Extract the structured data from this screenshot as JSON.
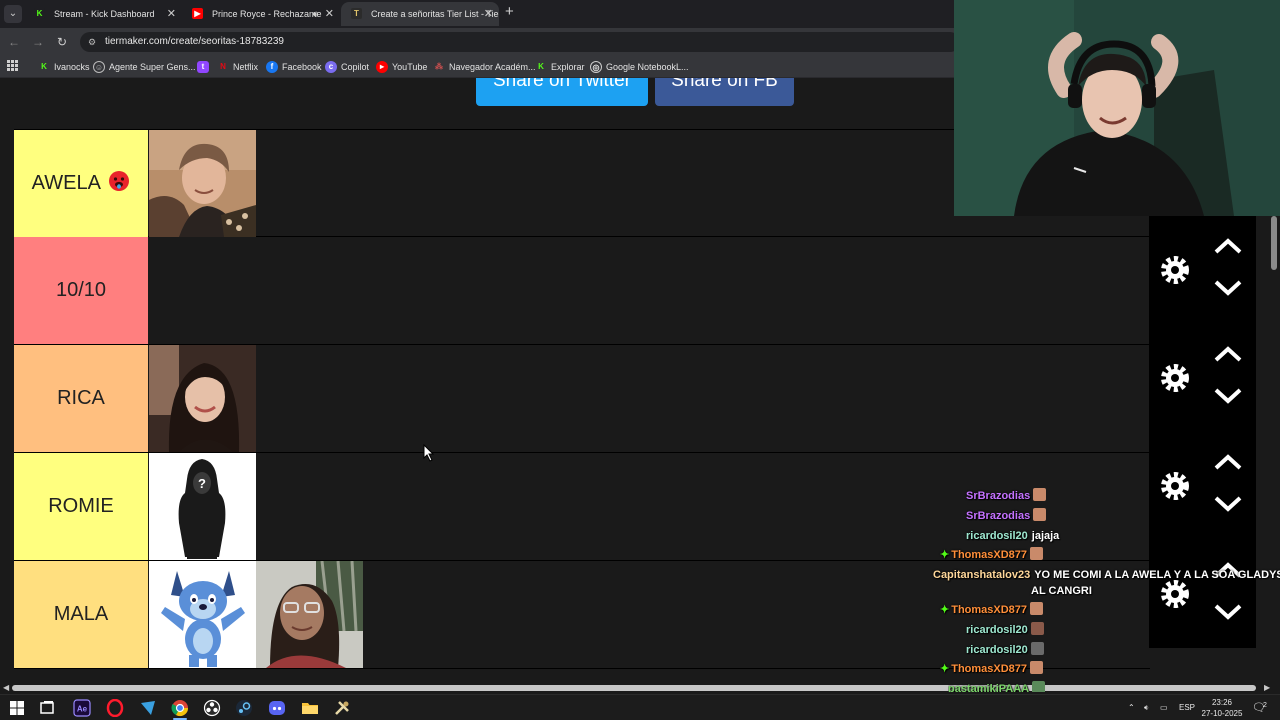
{
  "browser": {
    "tabs": [
      {
        "title": "Stream - Kick Dashboard",
        "favicon": "kick-icon",
        "active": false
      },
      {
        "title": "Prince Royce - Rechazame",
        "favicon": "youtube-icon",
        "active": false,
        "audio": true
      },
      {
        "title": "Create a señoritas Tier List - Tie",
        "favicon": "tiermaker-icon",
        "active": true
      }
    ],
    "url": "tiermaker.com/create/seoritas-18783239",
    "bookmarks": [
      {
        "label": "Ivanocks",
        "icon": "kick-icon",
        "color": "#53fc18"
      },
      {
        "label": "Agente Super Gens...",
        "icon": "agent-icon",
        "color": "#9aa0a6"
      },
      {
        "label": "",
        "icon": "twitch-icon",
        "color": "#9146ff"
      },
      {
        "label": "Netflix",
        "icon": "netflix-icon",
        "color": "#e50914"
      },
      {
        "label": "Facebook",
        "icon": "facebook-icon",
        "color": "#1877f2"
      },
      {
        "label": "Copilot",
        "icon": "copilot-icon",
        "color": "#7a6cf0"
      },
      {
        "label": "YouTube",
        "icon": "youtube-icon",
        "color": "#ff0000"
      },
      {
        "label": "Navegador Académ...",
        "icon": "navegador-icon",
        "color": "#d05050"
      },
      {
        "label": "Explorar",
        "icon": "kick-icon",
        "color": "#53fc18"
      },
      {
        "label": "Google NotebookL...",
        "icon": "notebooklm-icon",
        "color": "#e8e8e8"
      }
    ]
  },
  "page": {
    "share_twitter": "Share on Twitter",
    "share_fb": "Share on FB",
    "tiers": [
      {
        "label": "AWELA",
        "emoji": "hot-face-icon",
        "color": "#ffff7f",
        "items": [
          "grandmother-photo"
        ]
      },
      {
        "label": "10/10",
        "color": "#ff7f7f",
        "items": []
      },
      {
        "label": "RICA",
        "color": "#ffbf7f",
        "items": [
          "woman-photo"
        ]
      },
      {
        "label": "ROMIE",
        "color": "#ffff7f",
        "items": [
          "hooded-figure-image"
        ]
      },
      {
        "label": "MALA",
        "color": "#ffdf7f",
        "items": [
          "bluey-image",
          "woman-selfie-photo"
        ]
      }
    ]
  },
  "chat": {
    "messages": [
      {
        "user": "SrBrazodias",
        "color": "#c472ff",
        "text": "",
        "emote": true,
        "badge": false
      },
      {
        "user": "SrBrazodias",
        "color": "#c472ff",
        "text": "",
        "emote": true,
        "badge": false
      },
      {
        "user": "ricardosil20",
        "color": "#9ee8d0",
        "text": "jajaja",
        "emote": false,
        "badge": false
      },
      {
        "user": "ThomasXD877",
        "color": "#ff8f3a",
        "text": "",
        "emote": true,
        "badge": true
      },
      {
        "user": "Capitanshatalov23",
        "color": "#ffd79a",
        "text": "YO ME COMI A LA AWELA Y A LA SOA GLADYS..Y",
        "text2": "AL CANGRI",
        "emote": false,
        "badge": false
      },
      {
        "user": "ThomasXD877",
        "color": "#ff8f3a",
        "text": "",
        "emote": true,
        "badge": true
      },
      {
        "user": "ricardosil20",
        "color": "#9ee8d0",
        "text": "",
        "emote": true,
        "badge": false
      },
      {
        "user": "ricardosil20",
        "color": "#9ee8d0",
        "text": "",
        "emote": true,
        "badge": false
      },
      {
        "user": "ThomasXD877",
        "color": "#ff8f3a",
        "text": "",
        "emote": true,
        "badge": true
      },
      {
        "user": "pastamikiPAAA",
        "color": "#7bd36a",
        "text": "",
        "emote": true,
        "badge": false
      }
    ]
  },
  "taskbar": {
    "apps": [
      "windows-start-icon",
      "task-view-icon",
      "after-effects-icon",
      "opera-icon",
      "app-icon",
      "chrome-icon",
      "obs-icon",
      "steam-icon",
      "discord-icon",
      "file-explorer-icon",
      "tool-icon"
    ],
    "language": "ESP",
    "time": "23:26",
    "date": "27-10-2025",
    "notifications": "2"
  }
}
